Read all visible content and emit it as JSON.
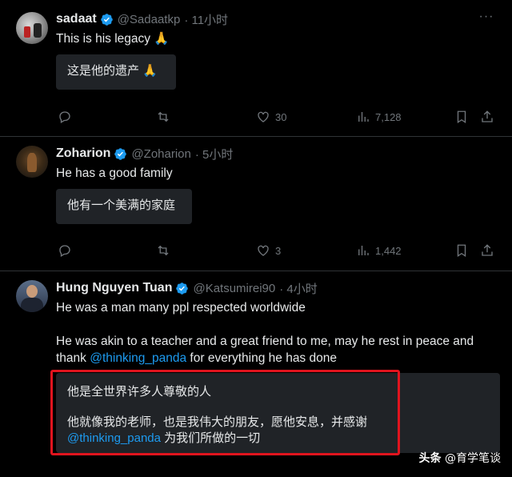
{
  "tweets": [
    {
      "name": "sadaat",
      "handle": "@Sadaatkp",
      "time": "· 11小时",
      "text": "This is his legacy 🙏",
      "translation": "这是他的遗产 🙏",
      "likes": "30",
      "views": "7,128"
    },
    {
      "name": "Zoharion",
      "handle": "@Zoharion",
      "time": "· 5小时",
      "text": "He has a good family",
      "translation": "他有一个美满的家庭",
      "likes": "3",
      "views": "1,442"
    },
    {
      "name": "Hung Nguyen Tuan",
      "handle": "@Katsumirei90",
      "time": "· 4小时",
      "text_line1": "He was a man many ppl respected worldwide",
      "text_line2": "He was akin to a teacher and a great friend to me, may he rest in peace and",
      "text_line3_pre": "thank ",
      "text_link": "@thinking_panda",
      "text_line3_post": " for everything he has done",
      "translation_line1": "他是全世界许多人尊敬的人",
      "translation_line2": "他就像我的老师，也是我伟大的朋友，愿他安息，并感谢",
      "translation_link": "@thinking_panda",
      "translation_line3_post": " 为我们所做的一切"
    }
  ],
  "watermark": {
    "brand": "头条",
    "account": "@育学笔谈"
  },
  "icons": [
    "verified-icon",
    "more-icon",
    "reply-icon",
    "retweet-icon",
    "like-icon",
    "views-icon",
    "bookmark-icon",
    "share-icon"
  ],
  "colors": {
    "background": "#000000",
    "link": "#1d9bf0",
    "muted": "#71767b",
    "highlight_box": "#e0141e"
  }
}
